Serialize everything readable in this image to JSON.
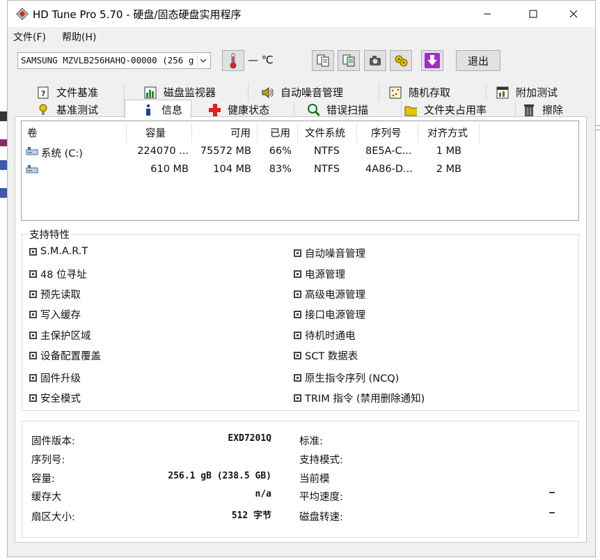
{
  "window": {
    "title": "HD Tune Pro 5.70 - 硬盘/固态硬盘实用程序",
    "minimize_icon": "minimize-icon",
    "maximize_icon": "maximize-icon",
    "close_icon": "close-icon"
  },
  "menu": {
    "items": [
      {
        "label": "文件(F)"
      },
      {
        "label": "帮助(H)"
      }
    ]
  },
  "toolbar": {
    "drive": "SAMSUNG MZVLB256HAHQ-00000 (256 g",
    "temperature": "— ℃",
    "exit_label": "退出",
    "buttons": [
      "copy-text-icon",
      "copy-all-icon",
      "camera-icon",
      "options-icon",
      "save-down-icon"
    ]
  },
  "tabs": {
    "row1": [
      {
        "label": "文件基准",
        "icon": "file-benchmark-icon"
      },
      {
        "label": "磁盘监视器",
        "icon": "disk-monitor-icon"
      },
      {
        "label": "自动噪音管理",
        "icon": "speaker-icon"
      },
      {
        "label": "随机存取",
        "icon": "random-access-icon"
      },
      {
        "label": "附加测试",
        "icon": "extra-tests-icon"
      }
    ],
    "row2": [
      {
        "label": "基准测试",
        "icon": "benchmark-icon"
      },
      {
        "label": "信息",
        "icon": "info-icon"
      },
      {
        "label": "健康状态",
        "icon": "health-cross-icon"
      },
      {
        "label": "错误扫描",
        "icon": "magnifier-icon"
      },
      {
        "label": "文件夹占用率",
        "icon": "folder-icon"
      },
      {
        "label": "擦除",
        "icon": "trash-icon"
      }
    ],
    "active": "信息"
  },
  "volumes": {
    "headers": [
      "卷",
      "容量",
      "可用",
      "已用",
      "文件系统",
      "序列号",
      "对齐方式"
    ],
    "rows": [
      {
        "name": "系统 (C:)",
        "capacity": "224070 ...",
        "free": "75572 MB",
        "used": "66%",
        "fs": "NTFS",
        "serial": "8E5A-C...",
        "align": "1 MB"
      },
      {
        "name": "",
        "capacity": "610 MB",
        "free": "104 MB",
        "used": "83%",
        "fs": "NTFS",
        "serial": "4A86-D...",
        "align": "2 MB"
      }
    ]
  },
  "features": {
    "title": "支持特性",
    "left": [
      "S.M.A.R.T",
      "48 位寻址",
      "预先读取",
      "写入缓存",
      "主保护区域",
      "设备配置覆盖",
      "固件升级",
      "安全模式"
    ],
    "right": [
      "自动噪音管理",
      "电源管理",
      "高级电源管理",
      "接口电源管理",
      "待机时通电",
      "SCT 数据表",
      "原生指令序列 (NCQ)",
      "TRIM 指令 (禁用删除通知)"
    ]
  },
  "info": {
    "left": [
      {
        "label": "固件版本:",
        "value": "EXD7201Q"
      },
      {
        "label": "序列号:",
        "value": ""
      },
      {
        "label": "容量:",
        "value": "256.1 gB (238.5 GB)"
      },
      {
        "label": "缓存大",
        "value": "n/a"
      },
      {
        "label": "扇区大小:",
        "value": "512 字节"
      }
    ],
    "right": [
      {
        "label": "标准:",
        "value": ""
      },
      {
        "label": "支持模式:",
        "value": ""
      },
      {
        "label": "当前模",
        "value": ""
      },
      {
        "label": "平均速度:",
        "value": "–"
      },
      {
        "label": "磁盘转速:",
        "value": "–"
      }
    ]
  }
}
